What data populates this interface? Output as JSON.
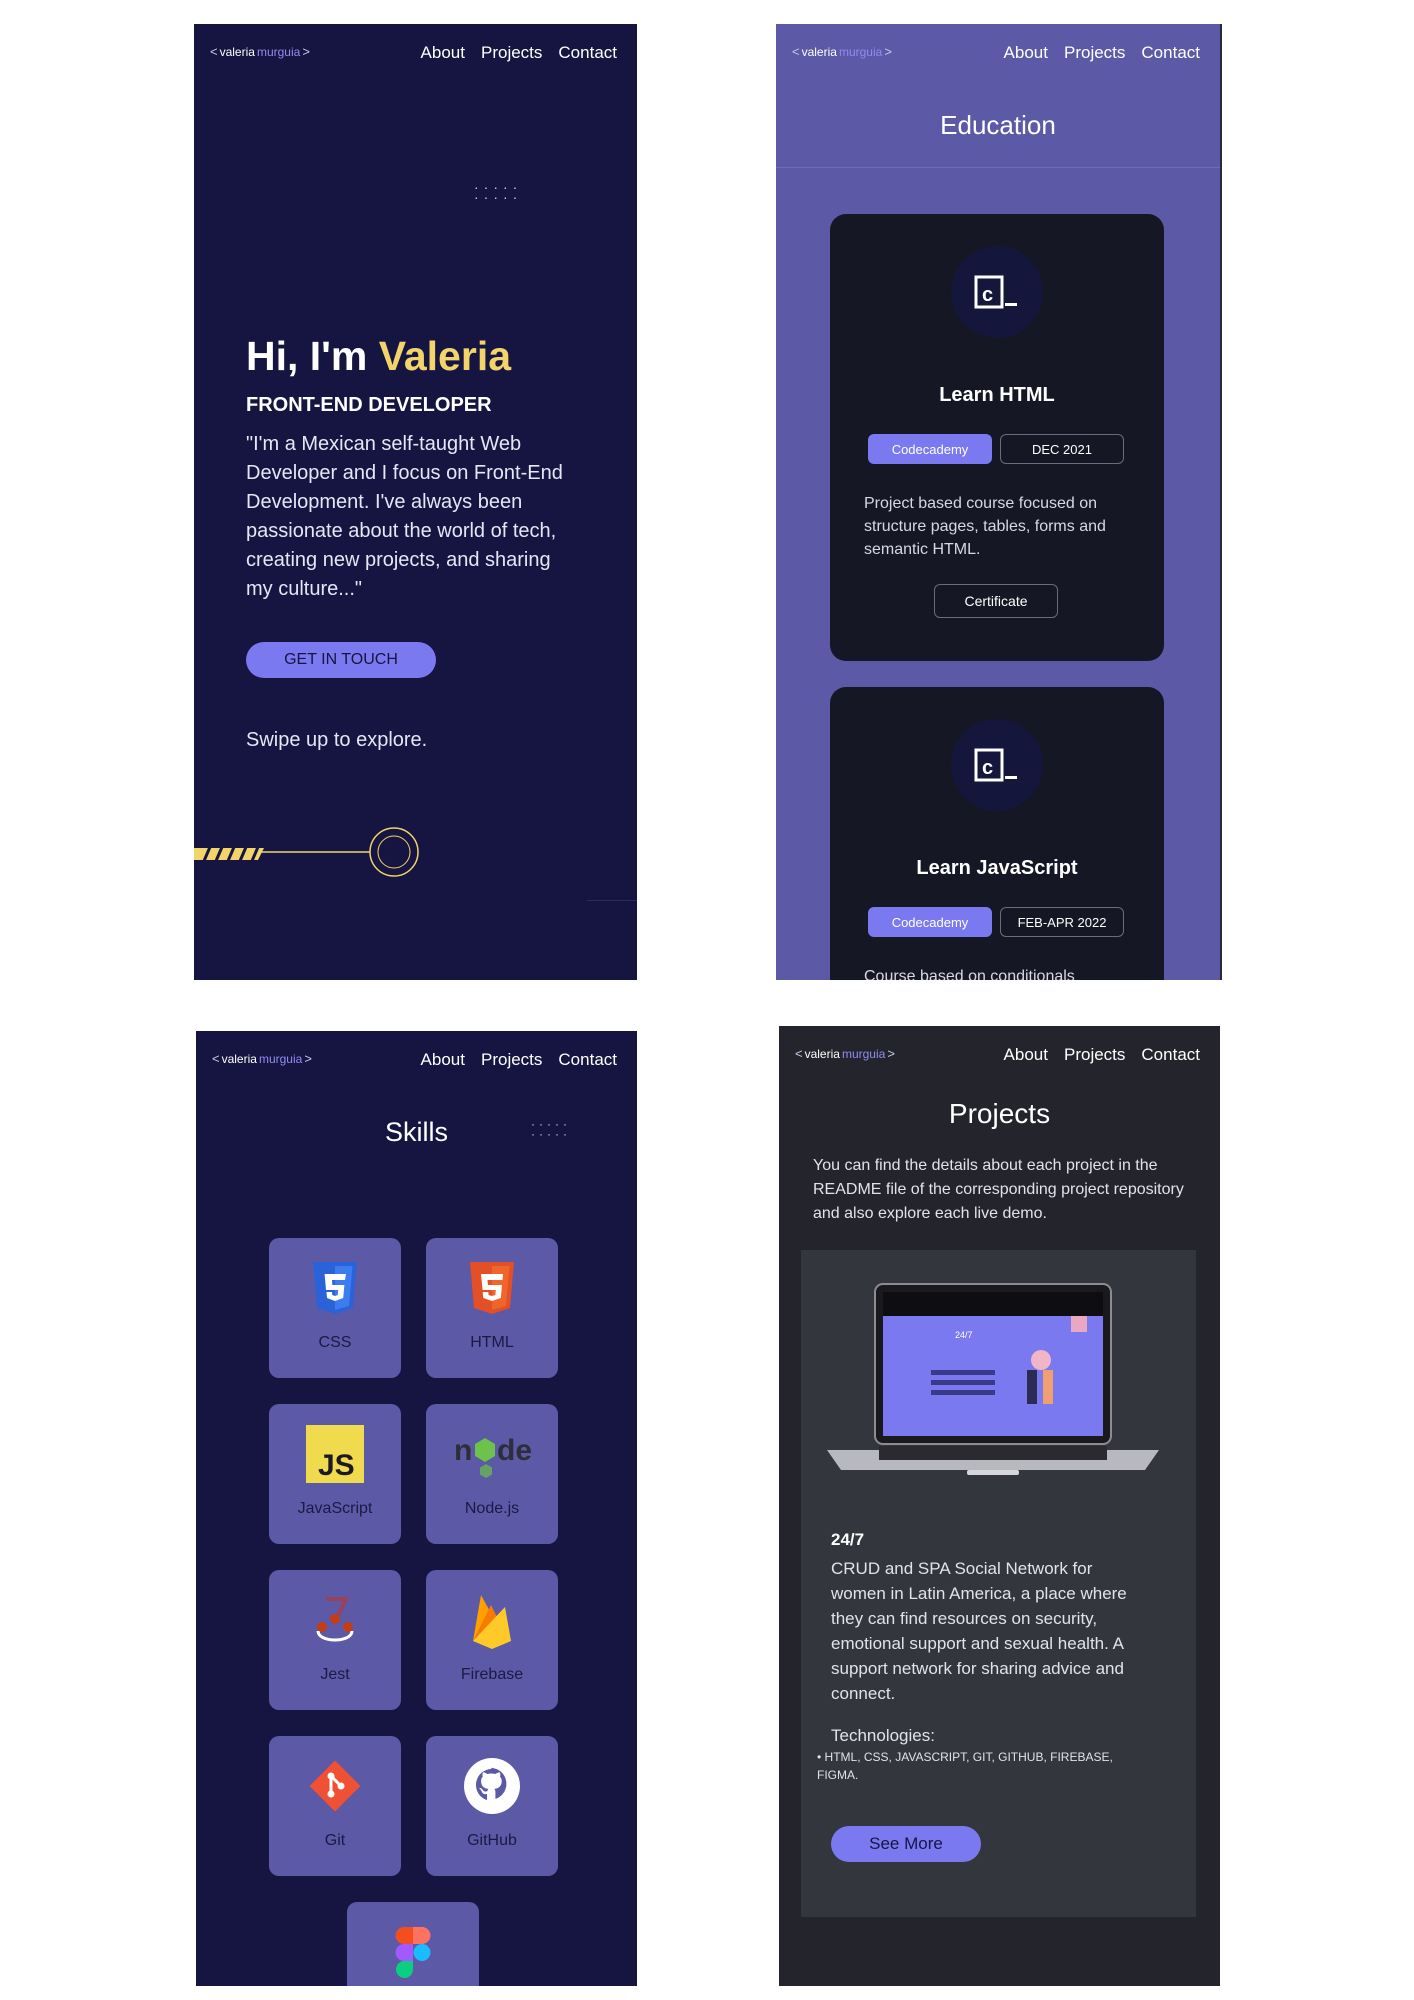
{
  "nav": {
    "logo_part1": "valeria",
    "logo_part2": "murguia",
    "links": [
      "About",
      "Projects",
      "Contact"
    ]
  },
  "hero": {
    "greeting": "Hi, I'm ",
    "name": "Valeria",
    "role": "FRONT-END DEVELOPER",
    "bio": "\"I'm a Mexican self-taught Web Developer and I focus on Front-End Development. I've always been passionate about the world of tech, creating new projects, and sharing my culture...\"",
    "cta": "GET IN TOUCH",
    "hint": "Swipe up to explore."
  },
  "education": {
    "title": "Education",
    "cards": [
      {
        "icon": "codecademy-logo",
        "title": "Learn HTML",
        "provider": "Codecademy",
        "date": "DEC 2021",
        "description": "Project based course focused on structure pages, tables, forms and semantic HTML.",
        "button": "Certificate"
      },
      {
        "icon": "codecademy-logo",
        "title": "Learn JavaScript",
        "provider": "Codecademy",
        "date": "FEB-APR 2022",
        "description": "Course based on conditionals"
      }
    ]
  },
  "skills": {
    "title": "Skills",
    "items": [
      {
        "label": "CSS",
        "icon": "css3-icon"
      },
      {
        "label": "HTML",
        "icon": "html5-icon"
      },
      {
        "label": "JavaScript",
        "icon": "javascript-icon"
      },
      {
        "label": "Node.js",
        "icon": "nodejs-icon"
      },
      {
        "label": "Jest",
        "icon": "jest-icon"
      },
      {
        "label": "Firebase",
        "icon": "firebase-icon"
      },
      {
        "label": "Git",
        "icon": "git-icon"
      },
      {
        "label": "GitHub",
        "icon": "github-icon"
      },
      {
        "label": "",
        "icon": "figma-icon"
      }
    ]
  },
  "projects": {
    "title": "Projects",
    "intro": "You can find the details about each project in the README file of the corresponding project repository and also explore each live demo.",
    "card": {
      "image": "laptop-mockup",
      "screen_text": "24/7",
      "name": "24/7",
      "description": "CRUD and SPA Social Network for women in Latin America, a place where they can find resources on security, emotional support and sexual health. A support network for sharing advice and connect.",
      "tech_heading": "Technologies:",
      "tech_list": "HTML, CSS, JAVASCRIPT, GIT, GITHUB, FIREBASE, FIGMA.",
      "button": "See More"
    }
  },
  "colors": {
    "navy": "#161542",
    "purple": "#5c59a6",
    "accent": "#7b79f0",
    "yellow": "#f2d46b",
    "dark": "#24252c"
  }
}
